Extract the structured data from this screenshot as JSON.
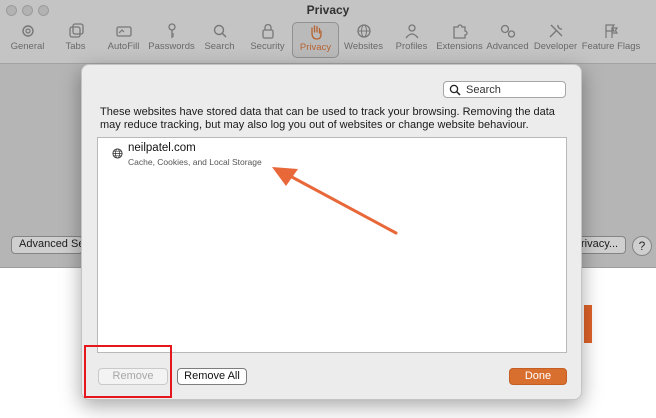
{
  "window": {
    "title": "Privacy",
    "toolbar": [
      {
        "label": "General",
        "icon": "gear-icon"
      },
      {
        "label": "Tabs",
        "icon": "tabs-icon"
      },
      {
        "label": "AutoFill",
        "icon": "autofill-icon"
      },
      {
        "label": "Passwords",
        "icon": "key-icon"
      },
      {
        "label": "Search",
        "icon": "search-icon"
      },
      {
        "label": "Security",
        "icon": "lock-icon"
      },
      {
        "label": "Privacy",
        "icon": "hand-icon",
        "active": true
      },
      {
        "label": "Websites",
        "icon": "globe-icon"
      },
      {
        "label": "Profiles",
        "icon": "person-icon"
      },
      {
        "label": "Extensions",
        "icon": "puzzle-icon"
      },
      {
        "label": "Advanced",
        "icon": "gears-icon"
      },
      {
        "label": "Developer",
        "icon": "wrench-icon"
      },
      {
        "label": "Feature Flags",
        "icon": "flags-icon"
      }
    ],
    "advanced_button": "Advanced Se",
    "privacy_button": "rivacy...",
    "help": "?"
  },
  "sheet": {
    "search_placeholder": "Search",
    "description": "These websites have stored data that can be used to track your browsing. Removing the data may reduce tracking, but may also log you out of websites or change website behaviour.",
    "sites": [
      {
        "name": "neilpatel.com",
        "detail": "Cache, Cookies, and Local Storage",
        "icon": "globe-icon"
      }
    ],
    "buttons": {
      "remove": "Remove",
      "remove_all": "Remove All",
      "done": "Done"
    }
  },
  "colors": {
    "accent": "#d96f2f",
    "annotation_arrow": "#e8683a",
    "annotation_box": "#e5161c"
  }
}
